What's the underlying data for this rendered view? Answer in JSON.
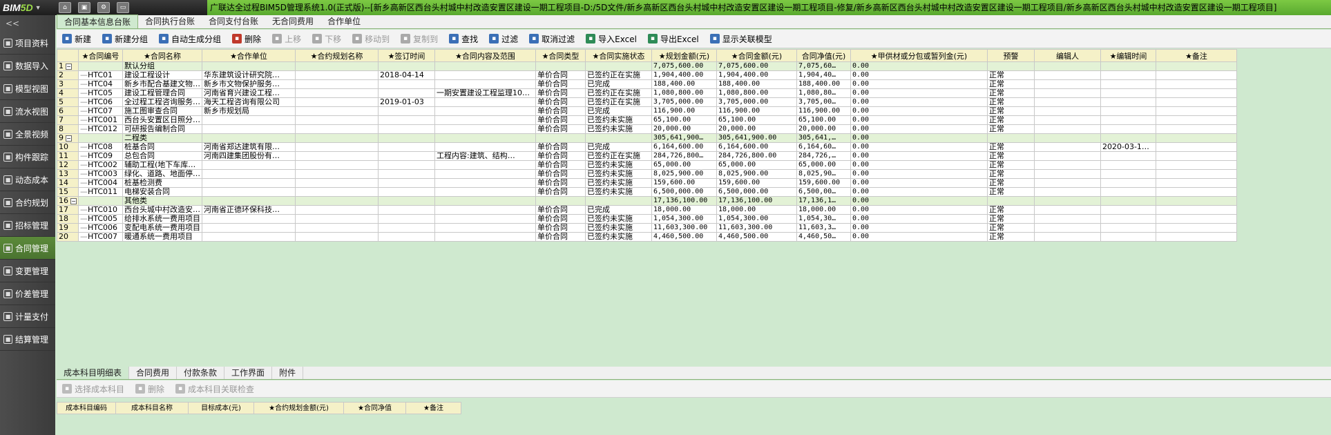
{
  "titlebar": {
    "logo_main": "BIM",
    "logo_five": "5D",
    "title": "广联达全过程BIM5D管理系统1.0(正式版)--[新乡高新区西台头村城中村改造安置区建设一期工程项目-D:/5D文件/新乡高新区西台头村城中村改造安置区建设一期工程项目-修复/新乡高新区西台头村城中村改造安置区建设一期工程项目/新乡高新区西台头村城中村改造安置区建设一期工程项目]"
  },
  "sidebar": {
    "collapse_label": "<<",
    "items": [
      {
        "label": "项目资料",
        "icon": "folder-icon"
      },
      {
        "label": "数据导入",
        "icon": "import-icon"
      },
      {
        "label": "模型视图",
        "icon": "model-icon"
      },
      {
        "label": "流水视图",
        "icon": "flow-icon"
      },
      {
        "label": "全景视频",
        "icon": "video-icon"
      },
      {
        "label": "构件跟踪",
        "icon": "track-icon"
      },
      {
        "label": "动态成本",
        "icon": "cost-icon"
      },
      {
        "label": "合约规划",
        "icon": "plan-icon"
      },
      {
        "label": "招标管理",
        "icon": "bid-icon"
      },
      {
        "label": "合同管理",
        "icon": "contract-icon",
        "active": true
      },
      {
        "label": "变更管理",
        "icon": "change-icon"
      },
      {
        "label": "价差管理",
        "icon": "price-icon"
      },
      {
        "label": "计量支付",
        "icon": "payment-icon"
      },
      {
        "label": "结算管理",
        "icon": "settle-icon"
      }
    ]
  },
  "tabs": [
    "合同基本信息台账",
    "合同执行台账",
    "合同支付台账",
    "无合同费用",
    "合作单位"
  ],
  "toolbar": [
    {
      "label": "新建",
      "icon": "new-icon",
      "color": "#3b6fb6"
    },
    {
      "label": "新建分组",
      "icon": "new-group-icon",
      "color": "#3b6fb6"
    },
    {
      "label": "自动生成分组",
      "icon": "auto-group-icon",
      "color": "#3b6fb6"
    },
    {
      "label": "删除",
      "icon": "delete-icon",
      "color": "#c0392b"
    },
    {
      "label": "上移",
      "icon": "up-icon",
      "color": "#aaaaaa",
      "disabled": true
    },
    {
      "label": "下移",
      "icon": "down-icon",
      "color": "#aaaaaa",
      "disabled": true
    },
    {
      "label": "移动到",
      "icon": "move-icon",
      "color": "#aaaaaa",
      "disabled": true
    },
    {
      "label": "复制到",
      "icon": "copy-icon",
      "color": "#aaaaaa",
      "disabled": true
    },
    {
      "label": "查找",
      "icon": "search-icon",
      "color": "#3b6fb6"
    },
    {
      "label": "过滤",
      "icon": "filter-icon",
      "color": "#3b6fb6"
    },
    {
      "label": "取消过滤",
      "icon": "clear-filter-icon",
      "color": "#3b6fb6"
    },
    {
      "label": "导入Excel",
      "icon": "import-excel-icon",
      "color": "#2e8b57"
    },
    {
      "label": "导出Excel",
      "icon": "export-excel-icon",
      "color": "#2e8b57"
    },
    {
      "label": "显示关联模型",
      "icon": "link-model-icon",
      "color": "#3b6fb6"
    }
  ],
  "grid": {
    "columns": [
      "",
      "★合同编号",
      "★合同名称",
      "★合作单位",
      "★合约规划名称",
      "★签订时间",
      "★合同内容及范围",
      "★合同类型",
      "★合同实施状态",
      "★规划金额(元)",
      "★合同金额(元)",
      "合同净值(元)",
      "★甲供材或分包或暂列金(元)",
      "预警",
      "编辑人",
      "★编辑时间",
      "★备注"
    ],
    "rows": [
      {
        "type": "group",
        "cells": [
          "1",
          "",
          "默认分组",
          "",
          "",
          "",
          "",
          "",
          "",
          "7,075,600.00",
          "7,075,600.00",
          "7,075,60…",
          "0.00",
          "",
          "",
          "",
          ""
        ]
      },
      {
        "type": "row",
        "cells": [
          "2",
          "HTC01",
          "建设工程设计",
          "华东建筑设计研究院…",
          "",
          "2018-04-14",
          "",
          "单价合同",
          "已签约正在实施",
          "1,904,400.00",
          "1,904,400.00",
          "1,904,40…",
          "0.00",
          "正常",
          "",
          "",
          ""
        ]
      },
      {
        "type": "row",
        "cells": [
          "3",
          "HTC04",
          "新乡市配合基建文物…",
          "新乡市文物保护服务…",
          "",
          "",
          "",
          "单价合同",
          "已完成",
          "188,400.00",
          "188,400.00",
          "188,400.00",
          "0.00",
          "正常",
          "",
          "",
          ""
        ]
      },
      {
        "type": "row",
        "cells": [
          "4",
          "HTC05",
          "建设工程管理合同",
          "河南省育兴建设工程…",
          "",
          "",
          "一期安置建设工程监理10…",
          "单价合同",
          "已签约正在实施",
          "1,080,800.00",
          "1,080,800.00",
          "1,080,80…",
          "0.00",
          "正常",
          "",
          "",
          ""
        ]
      },
      {
        "type": "row",
        "cells": [
          "5",
          "HTC06",
          "全过程工程咨询服务…",
          "海天工程咨询有限公司",
          "",
          "2019-01-03",
          "",
          "单价合同",
          "已签约正在实施",
          "3,705,000.00",
          "3,705,000.00",
          "3,705,00…",
          "0.00",
          "正常",
          "",
          "",
          ""
        ]
      },
      {
        "type": "row",
        "cells": [
          "6",
          "HTC07",
          "施工图审查合同",
          "新乡市规划局",
          "",
          "",
          "",
          "单价合同",
          "已完成",
          "116,900.00",
          "116,900.00",
          "116,900.00",
          "0.00",
          "正常",
          "",
          "",
          ""
        ]
      },
      {
        "type": "row",
        "cells": [
          "7",
          "HTC001",
          "西台头安置区日照分…",
          "",
          "",
          "",
          "",
          "单价合同",
          "已签约未实施",
          "65,100.00",
          "65,100.00",
          "65,100.00",
          "0.00",
          "正常",
          "",
          "",
          ""
        ]
      },
      {
        "type": "row",
        "cells": [
          "8",
          "HTC012",
          "可研报告编制合同",
          "",
          "",
          "",
          "",
          "单价合同",
          "已签约未实施",
          "20,000.00",
          "20,000.00",
          "20,000.00",
          "0.00",
          "正常",
          "",
          "",
          ""
        ]
      },
      {
        "type": "group",
        "cells": [
          "9",
          "",
          "二程类",
          "",
          "",
          "",
          "",
          "",
          "",
          "305,641,900…",
          "305,641,900.00",
          "305,641,…",
          "0.00",
          "",
          "",
          "",
          ""
        ]
      },
      {
        "type": "row",
        "cells": [
          "10",
          "HTC08",
          "桩基合同",
          "河南省郑达建筑有限…",
          "",
          "",
          "",
          "单价合同",
          "已完成",
          "6,164,600.00",
          "6,164,600.00",
          "6,164,60…",
          "0.00",
          "正常",
          "",
          "2020-03-1…",
          ""
        ]
      },
      {
        "type": "row",
        "cells": [
          "11",
          "HTC09",
          "总包合同",
          "河南四建集团股份有…",
          "",
          "",
          "工程内容:建筑、结构…",
          "单价合同",
          "已签约正在实施",
          "284,726,800…",
          "284,726,800.00",
          "284,726,…",
          "0.00",
          "正常",
          "",
          "",
          ""
        ]
      },
      {
        "type": "row",
        "cells": [
          "12",
          "HTC002",
          "辅助工程(地下车库…",
          "",
          "",
          "",
          "",
          "单价合同",
          "已签约未实施",
          "65,000.00",
          "65,000.00",
          "65,000.00",
          "0.00",
          "正常",
          "",
          "",
          ""
        ]
      },
      {
        "type": "row",
        "cells": [
          "13",
          "HTC003",
          "绿化、道路、地面停…",
          "",
          "",
          "",
          "",
          "单价合同",
          "已签约未实施",
          "8,025,900.00",
          "8,025,900.00",
          "8,025,90…",
          "0.00",
          "正常",
          "",
          "",
          ""
        ]
      },
      {
        "type": "row",
        "cells": [
          "14",
          "HTC004",
          "桩基检测费",
          "",
          "",
          "",
          "",
          "单价合同",
          "已签约未实施",
          "159,600.00",
          "159,600.00",
          "159,600.00",
          "0.00",
          "正常",
          "",
          "",
          ""
        ]
      },
      {
        "type": "row",
        "cells": [
          "15",
          "HTC011",
          "电梯安装合同",
          "",
          "",
          "",
          "",
          "单价合同",
          "已签约未实施",
          "6,500,000.00",
          "6,500,000.00",
          "6,500,00…",
          "0.00",
          "正常",
          "",
          "",
          ""
        ]
      },
      {
        "type": "group",
        "cells": [
          "16",
          "",
          "其他类",
          "",
          "",
          "",
          "",
          "",
          "",
          "17,136,100.00",
          "17,136,100.00",
          "17,136,1…",
          "0.00",
          "",
          "",
          "",
          ""
        ]
      },
      {
        "type": "row",
        "cells": [
          "17",
          "HTC010",
          "西台头城中村改造安…",
          "河南省正德环保科技…",
          "",
          "",
          "",
          "单价合同",
          "已完成",
          "18,000.00",
          "18,000.00",
          "18,000.00",
          "0.00",
          "正常",
          "",
          "",
          ""
        ]
      },
      {
        "type": "row",
        "cells": [
          "18",
          "HTC005",
          "给排水系统一费用项目",
          "",
          "",
          "",
          "",
          "单价合同",
          "已签约未实施",
          "1,054,300.00",
          "1,054,300.00",
          "1,054,30…",
          "0.00",
          "正常",
          "",
          "",
          ""
        ]
      },
      {
        "type": "row",
        "cells": [
          "19",
          "HTC006",
          "变配电系统一费用项目",
          "",
          "",
          "",
          "",
          "单价合同",
          "已签约未实施",
          "11,603,300.00",
          "11,603,300.00",
          "11,603,3…",
          "0.00",
          "正常",
          "",
          "",
          ""
        ]
      },
      {
        "type": "row",
        "cells": [
          "20",
          "HTC007",
          "暖通系统一费用项目",
          "",
          "",
          "",
          "",
          "单价合同",
          "已签约未实施",
          "4,460,500.00",
          "4,460,500.00",
          "4,460,50…",
          "0.00",
          "正常",
          "",
          "",
          ""
        ]
      }
    ]
  },
  "bottom_tabs": [
    "成本科目明细表",
    "合同费用",
    "付款条款",
    "工作界面",
    "附件"
  ],
  "bottom_toolbar": [
    {
      "label": "选择成本科目",
      "icon": "select-subject-icon"
    },
    {
      "label": "删除",
      "icon": "delete-icon"
    },
    {
      "label": "成本科目关联检查",
      "icon": "check-icon"
    }
  ],
  "bottom_grid": {
    "columns": [
      "成本科目编码",
      "成本科目名称",
      "目标成本(元)",
      "★合约规划金额(元)",
      "★合同净值",
      "★备注"
    ]
  },
  "colors": {
    "accent_green": "#59a92f",
    "grid_bg": "#cfe9cf",
    "header_bg": "#f5f1c8",
    "group_row": "#e3f2d6"
  }
}
